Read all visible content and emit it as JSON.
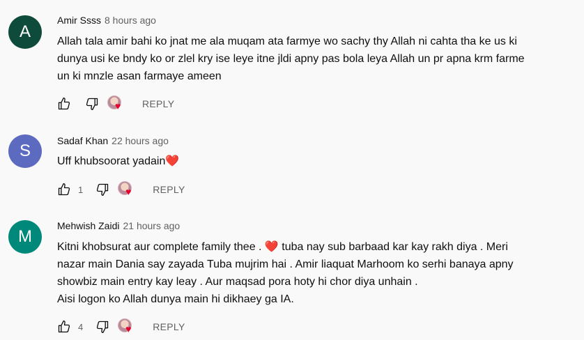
{
  "comments": [
    {
      "author": "Amir Ssss",
      "time": "8 hours ago",
      "avatar_letter": "A",
      "avatar_color": "#0f4b3a",
      "lines": [
        "Allah tala amir bahi ko jnat me ala muqam ata farmye wo sachy thy Allah ni cahta tha ke us ki",
        "dunya usi ke bndy ko or zlel kry ise leye itne jldi apny pas bola leya Allah un pr apna krm farme",
        "un ki mnzle asan farmaye ameen"
      ],
      "likes": "",
      "reply_label": "REPLY"
    },
    {
      "author": "Sadaf Khan",
      "time": "22 hours ago",
      "avatar_letter": "S",
      "avatar_color": "#5c6bc0",
      "lines": [
        "Uff khubsoorat yadain❤️"
      ],
      "likes": "1",
      "reply_label": "REPLY"
    },
    {
      "author": "Mehwish Zaidi",
      "time": "21 hours ago",
      "avatar_letter": "M",
      "avatar_color": "#00897b",
      "lines": [
        "Kitni khobsurat aur complete family thee . ❤️ tuba nay sub barbaad kar kay rakh diya . Meri",
        "nazar main Dania say zayada Tuba mujrim hai . Amir liaquat Marhoom ko serhi banaya apny",
        "showbiz main entry kay leay . Aur maqsad pora hoty hi chor diya unhain .",
        "Aisi logon ko Allah dunya main hi dikhaey ga IA."
      ],
      "likes": "4",
      "reply_label": "REPLY"
    }
  ],
  "icons": {
    "like": "thumb-up-outline-icon",
    "dislike": "thumb-down-outline-icon",
    "creator_heart": "creator-heart-icon"
  }
}
